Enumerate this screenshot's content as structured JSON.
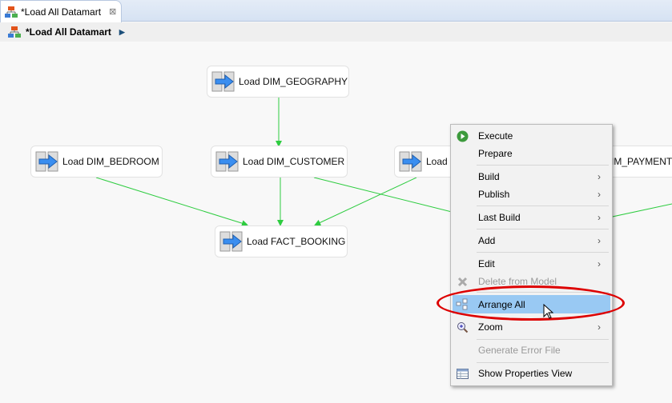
{
  "tab": {
    "title": "*Load All Datamart",
    "close": "⊠"
  },
  "breadcrumb": {
    "title": "*Load All Datamart"
  },
  "nodes": {
    "geography": "Load DIM_GEOGRAPHY",
    "bedroom": "Load DIM_BEDROOM",
    "customer": "Load DIM_CUSTOMER",
    "payment_left": "Load",
    "payment_right": "IM_PAYMENT_",
    "fact": "Load FACT_BOOKING"
  },
  "menu": {
    "execute": "Execute",
    "prepare": "Prepare",
    "build": "Build",
    "publish": "Publish",
    "last_build": "Last Build",
    "add": "Add",
    "edit": "Edit",
    "delete": "Delete from Model",
    "arrange_all": "Arrange All",
    "zoom": "Zoom",
    "generate_error": "Generate Error File",
    "show_properties": "Show Properties View",
    "submenu": "›"
  },
  "colors": {
    "edge": "#2ecc40",
    "highlight": "#99c9f3",
    "annotation": "#dd0000"
  }
}
